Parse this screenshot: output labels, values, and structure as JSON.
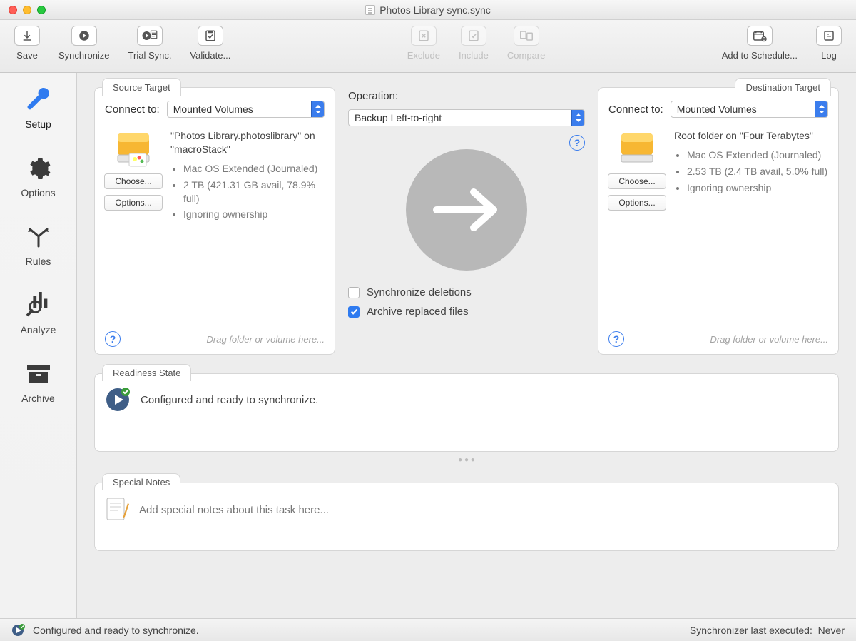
{
  "window": {
    "title": "Photos Library sync.sync"
  },
  "toolbar": {
    "save": "Save",
    "synchronize": "Synchronize",
    "trial_sync": "Trial Sync.",
    "validate": "Validate...",
    "exclude": "Exclude",
    "include": "Include",
    "compare": "Compare",
    "add_to_schedule": "Add to Schedule...",
    "log": "Log"
  },
  "sidebar": {
    "items": [
      {
        "label": "Setup"
      },
      {
        "label": "Options"
      },
      {
        "label": "Rules"
      },
      {
        "label": "Analyze"
      },
      {
        "label": "Archive"
      }
    ]
  },
  "source": {
    "tab": "Source Target",
    "connect_label": "Connect to:",
    "connect_value": "Mounted Volumes",
    "title": "\"Photos Library.photoslibrary\" on \"macroStack\"",
    "bullets": [
      "Mac OS Extended (Journaled)",
      "2 TB (421.31 GB avail, 78.9% full)",
      "Ignoring ownership"
    ],
    "choose": "Choose...",
    "options": "Options...",
    "drag_hint": "Drag folder or volume here..."
  },
  "destination": {
    "tab": "Destination Target",
    "connect_label": "Connect to:",
    "connect_value": "Mounted Volumes",
    "title": "Root folder on \"Four Terabytes\"",
    "bullets": [
      "Mac OS Extended (Journaled)",
      "2.53 TB (2.4 TB avail, 5.0% full)",
      "Ignoring ownership"
    ],
    "choose": "Choose...",
    "options": "Options...",
    "drag_hint": "Drag folder or volume here..."
  },
  "operation": {
    "label": "Operation:",
    "value": "Backup Left-to-right",
    "sync_deletions_label": "Synchronize deletions",
    "archive_replaced_label": "Archive replaced files"
  },
  "readiness": {
    "tab": "Readiness State",
    "text": "Configured and ready to synchronize."
  },
  "notes": {
    "tab": "Special Notes",
    "placeholder": "Add special notes about this task here..."
  },
  "statusbar": {
    "left": "Configured and ready to synchronize.",
    "right_label": "Synchronizer last executed:",
    "right_value": "Never"
  }
}
